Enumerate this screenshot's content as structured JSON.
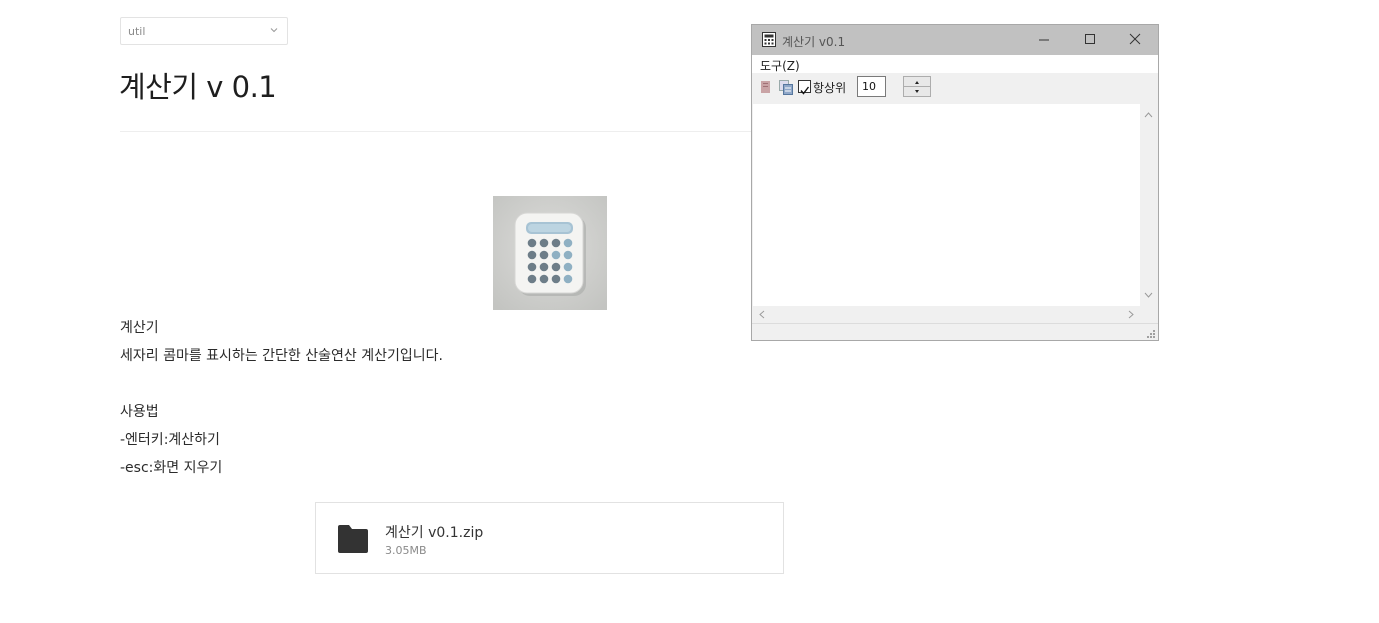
{
  "category_select": {
    "value": "util"
  },
  "page": {
    "title": "계산기 v 0.1"
  },
  "content": {
    "heading": "계산기",
    "description": "세자리 콤마를 표시하는 간단한 산술연산 계산기입니다.",
    "usage_title": "사용법",
    "usage_items": [
      "-엔터키:계산하기",
      "-esc:화면 지우기"
    ]
  },
  "attachment": {
    "filename": "계산기 v0.1.zip",
    "size": "3.05MB"
  },
  "app_window": {
    "title": "계산기 v0.1",
    "menu": [
      "도구(Z)"
    ],
    "always_on_top_label": "항상위",
    "always_on_top_checked": true,
    "font_size_value": "10"
  },
  "icons": {
    "select": "chevron-down-icon",
    "image": "calculator-image",
    "file": "folder-icon",
    "window": [
      "app-icon",
      "minimize-icon",
      "maximize-icon",
      "close-icon",
      "clear-icon",
      "copy-icon"
    ]
  }
}
